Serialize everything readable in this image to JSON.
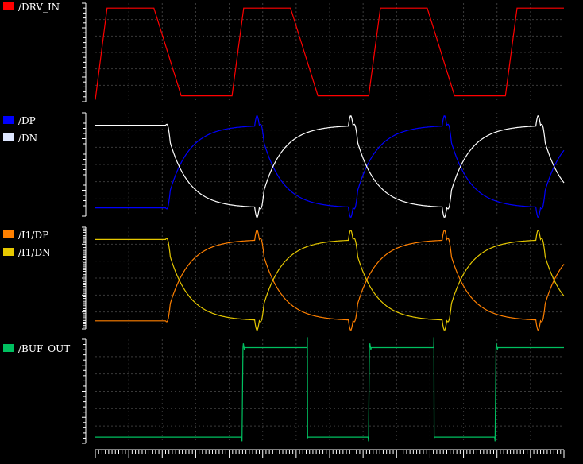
{
  "chart_data": [
    {
      "type": "line",
      "series": [
        {
          "name": "/DRV_IN",
          "color": "#ff0000",
          "x": [
            0,
            3,
            15,
            22,
            35,
            38,
            50,
            57,
            70,
            73,
            85,
            92,
            105,
            108,
            120
          ],
          "y": [
            0.02,
            0.95,
            0.95,
            0.06,
            0.06,
            0.95,
            0.95,
            0.06,
            0.06,
            0.95,
            0.95,
            0.06,
            0.06,
            0.95,
            0.95
          ]
        }
      ]
    },
    {
      "type": "line",
      "series": [
        {
          "name": "/DP",
          "color": "#0000ff",
          "shape": "settle_a"
        },
        {
          "name": "/DN",
          "color": "#ffffff",
          "shape": "settle_b"
        }
      ]
    },
    {
      "type": "line",
      "series": [
        {
          "name": "/I1/DP",
          "color": "#ff8000",
          "shape": "settle_a"
        },
        {
          "name": "/I1/DN",
          "color": "#e6c800",
          "shape": "settle_b"
        }
      ]
    },
    {
      "type": "line",
      "series": [
        {
          "name": "/BUF_OUT",
          "color": "#00c060",
          "x": [
            0,
            31.2,
            31.3,
            31.5,
            31.6,
            31.8,
            31.9,
            45.2,
            45.25,
            45.3,
            45.35,
            45.5,
            58.2,
            58.3,
            58.5,
            58.6,
            58.8,
            58.9,
            72.2,
            72.25,
            72.3,
            72.35,
            72.5,
            85.2,
            85.3,
            85.5,
            85.6,
            85.8,
            85.9,
            100
          ],
          "y": [
            0.06,
            0.06,
            0.02,
            0.92,
            0.96,
            0.9,
            0.92,
            0.92,
            1.02,
            0.05,
            0.06,
            0.06,
            0.06,
            0.02,
            0.92,
            0.96,
            0.9,
            0.92,
            0.92,
            1.02,
            0.05,
            0.06,
            0.06,
            0.06,
            0.02,
            0.92,
            0.96,
            0.9,
            0.92,
            0.92
          ]
        }
      ]
    }
  ]
}
